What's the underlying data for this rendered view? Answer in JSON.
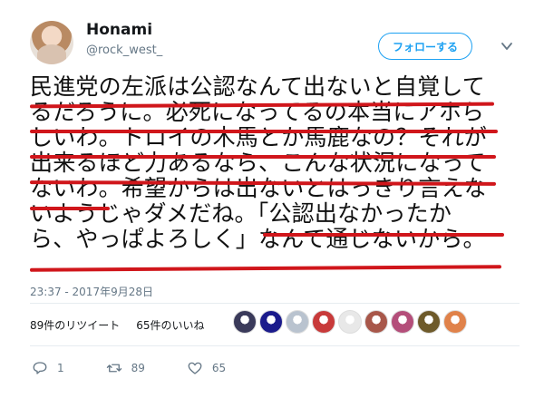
{
  "header": {
    "display_name": "Honami",
    "handle": "@rock_west_",
    "follow_label": "フォローする"
  },
  "tweet": {
    "lines": [
      "民進党の左派は公認なんて出ないと自覚して",
      "るだろうに。必死になってるの本当にアホら",
      "しいわ。トロイの木馬とか馬鹿なの？それが",
      "出来るほど力あるなら、こんな状況になって",
      "ないわ。希望からは出ないとはっきり言えな",
      "いようじゃダメだね。「公認出なかったか",
      "ら、やっぱよろしく」なんて通じないから。"
    ],
    "timestamp": "23:37 - 2017年9月28日",
    "underline_color": "#d0161b"
  },
  "stats": {
    "retweets": "89件のリツイート",
    "likes": "65件のいいね"
  },
  "actions": {
    "reply_count": "1",
    "retweet_count": "89",
    "like_count": "65"
  },
  "likers": [
    {
      "icon": "liker-avatar-1",
      "color": "#3a3a5a"
    },
    {
      "icon": "liker-avatar-2",
      "color": "#1b1b8c"
    },
    {
      "icon": "liker-avatar-3",
      "color": "#b9c3cf"
    },
    {
      "icon": "liker-avatar-4",
      "color": "#c83a3a"
    },
    {
      "icon": "liker-avatar-5",
      "color": "#e8e8e8"
    },
    {
      "icon": "liker-avatar-6",
      "color": "#a8574a"
    },
    {
      "icon": "liker-avatar-7",
      "color": "#b44e7a"
    },
    {
      "icon": "liker-avatar-8",
      "color": "#6e5a2a"
    },
    {
      "icon": "liker-avatar-9",
      "color": "#e0824a"
    }
  ],
  "colors": {
    "accent": "#1da1f2",
    "secondary_text": "#657786"
  }
}
